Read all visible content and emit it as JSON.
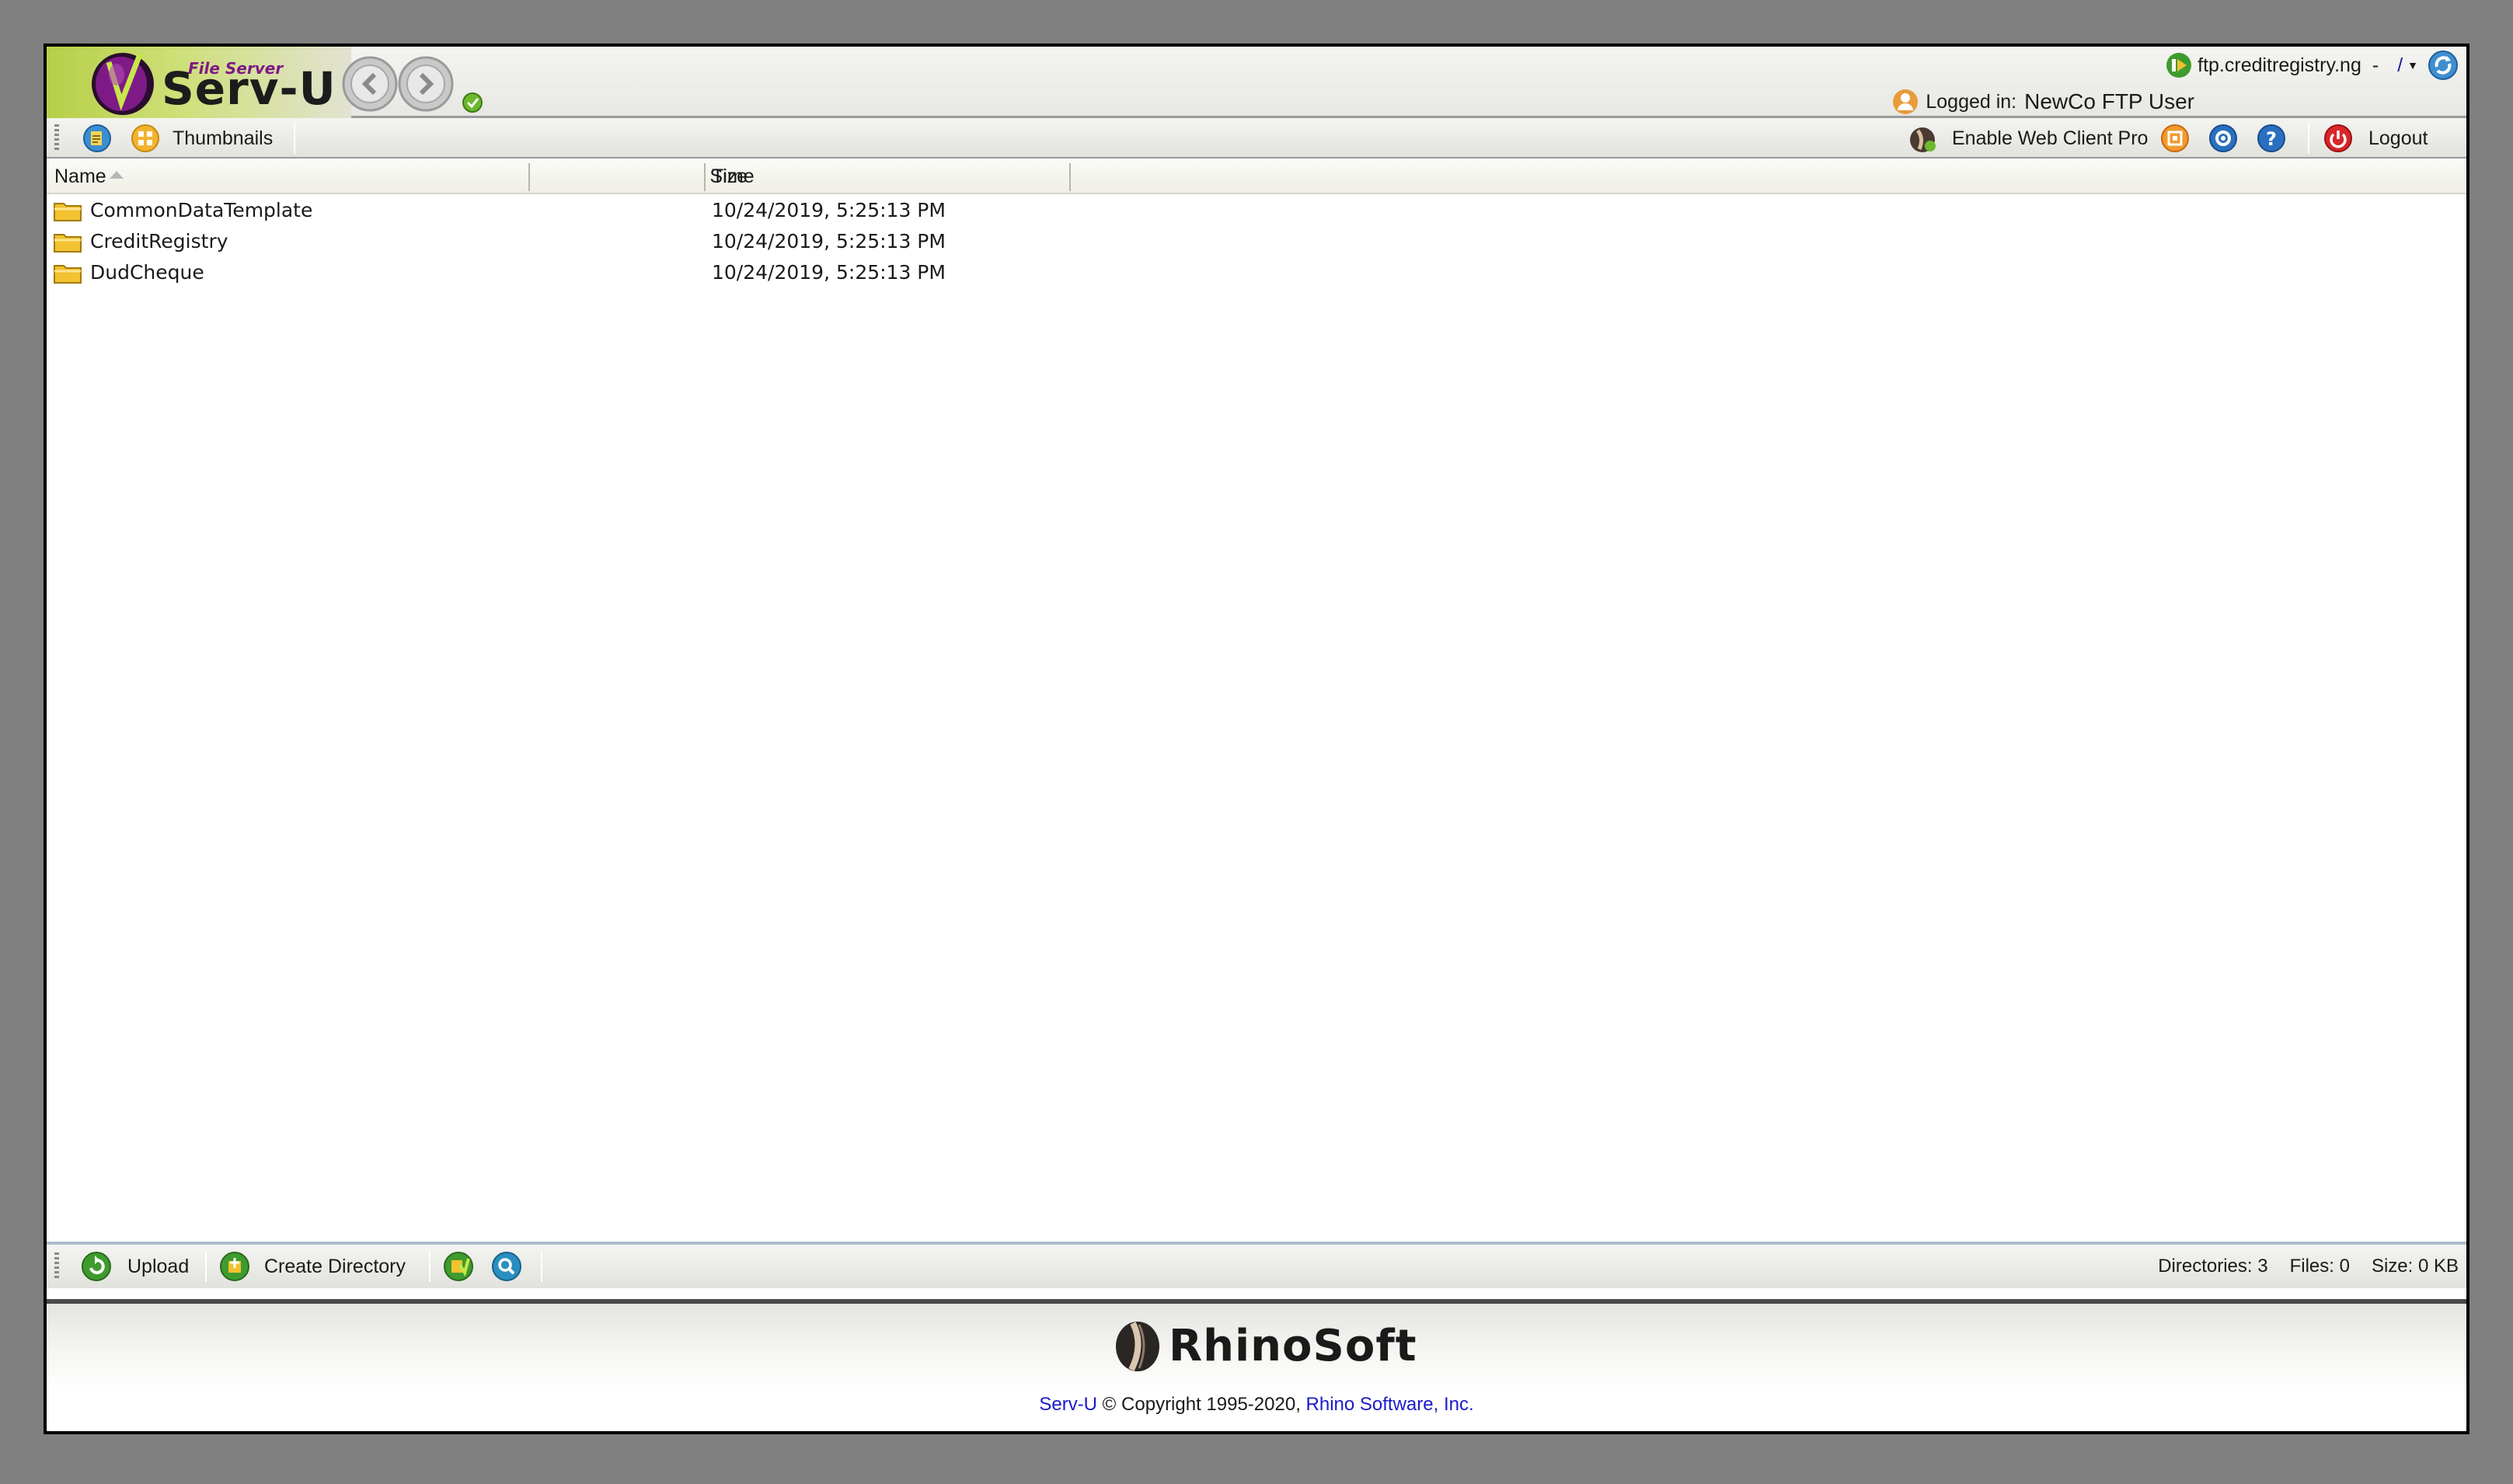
{
  "header": {
    "logo_small": "File Server",
    "logo_big": "Serv-U",
    "server": "ftp.creditregistry.ng",
    "separator": "-",
    "path": "/",
    "logged_in_label": "Logged in:",
    "user": "NewCo FTP User"
  },
  "toolbar": {
    "thumbnails_label": "Thumbnails",
    "enable_pro_label": "Enable Web Client Pro",
    "logout_label": "Logout"
  },
  "columns": {
    "name": "Name",
    "size": "Size",
    "time": "Time"
  },
  "files": [
    {
      "name": "CommonDataTemplate",
      "size": "",
      "time": "10/24/2019, 5:25:13 PM",
      "type": "folder"
    },
    {
      "name": "CreditRegistry",
      "size": "",
      "time": "10/24/2019, 5:25:13 PM",
      "type": "folder"
    },
    {
      "name": "DudCheque",
      "size": "",
      "time": "10/24/2019, 5:25:13 PM",
      "type": "folder"
    }
  ],
  "bottombar": {
    "upload_label": "Upload",
    "create_dir_label": "Create Directory",
    "directories": "Directories: 3",
    "files": "Files: 0",
    "size": "Size: 0 KB"
  },
  "footer": {
    "brand": "RhinoSoft",
    "product_link": "Serv-U",
    "copyright": " © Copyright 1995-2020, ",
    "company_link": "Rhino Software, Inc."
  },
  "colors": {
    "accent_green": "#b6cf47",
    "logo_purple": "#7e1a86",
    "link_blue": "#1a1acc",
    "folder_yellow": "#f2c230"
  },
  "icons": [
    "serv-u-logo-icon",
    "back-arrow-icon",
    "forward-arrow-icon",
    "connected-icon",
    "refresh-icon",
    "user-icon",
    "view-icon",
    "thumbnails-icon",
    "web-client-pro-icon",
    "share-icon",
    "settings-icon",
    "help-icon",
    "logout-icon",
    "folder-icon",
    "upload-icon",
    "create-directory-icon",
    "download-icon",
    "search-icon",
    "rhinosoft-logo-icon"
  ]
}
